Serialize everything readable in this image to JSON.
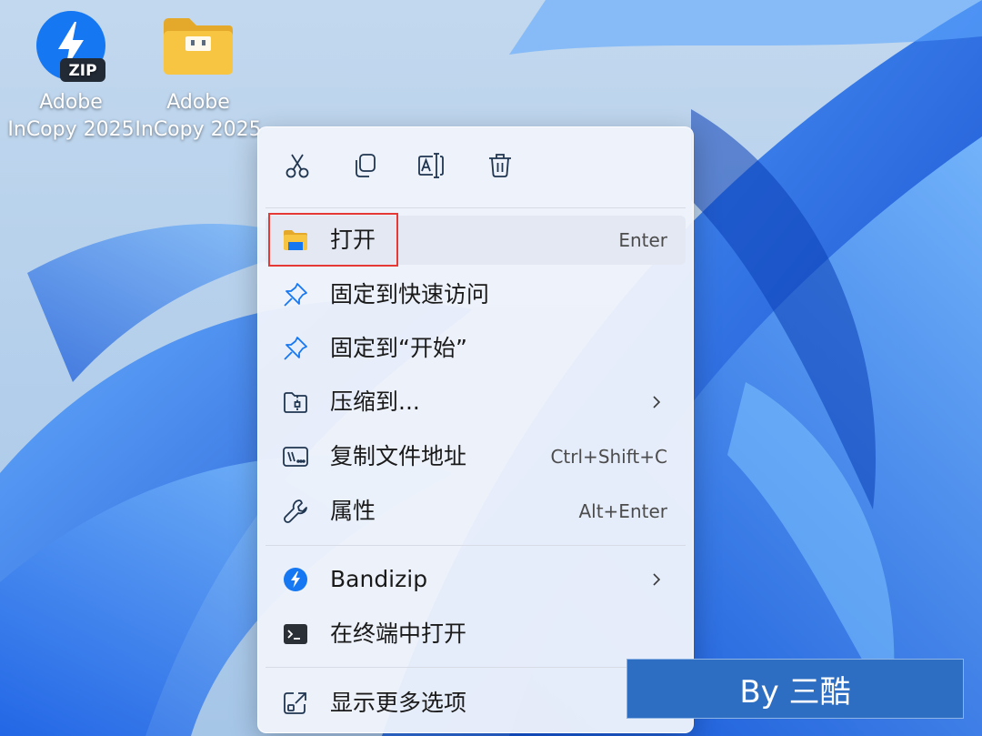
{
  "desktop": {
    "icons": [
      {
        "line1": "Adobe",
        "line2": "InCopy 2025",
        "type": "zip-archive-icon",
        "badge": "ZIP"
      },
      {
        "line1": "Adobe",
        "line2": "InCopy 2025",
        "type": "folder-icon"
      }
    ]
  },
  "context_menu": {
    "toolbar": [
      "cut-icon",
      "copy-icon",
      "rename-icon",
      "delete-icon"
    ],
    "items": [
      {
        "label": "打开",
        "shortcut": "Enter",
        "icon": "folder-icon"
      },
      {
        "label": "固定到快速访问",
        "icon": "pin-icon"
      },
      {
        "label": "固定到“开始”",
        "icon": "pin-icon"
      },
      {
        "label": "压缩到...",
        "icon": "zip-folder-icon",
        "submenu": true
      },
      {
        "label": "复制文件地址",
        "shortcut": "Ctrl+Shift+C",
        "icon": "copy-path-icon"
      },
      {
        "label": "属性",
        "shortcut": "Alt+Enter",
        "icon": "wrench-icon"
      },
      {
        "label": "Bandizip",
        "icon": "bandizip-icon",
        "submenu": true
      },
      {
        "label": "在终端中打开",
        "icon": "terminal-icon"
      },
      {
        "label": "显示更多选项",
        "icon": "more-options-icon"
      }
    ]
  },
  "watermark": {
    "text": "By 三酷"
  },
  "colors": {
    "accent": "#0f6cbd",
    "highlight_border": "#e53935",
    "watermark_bg": "#2d6ec2",
    "folder_yellow": "#f8c542"
  }
}
